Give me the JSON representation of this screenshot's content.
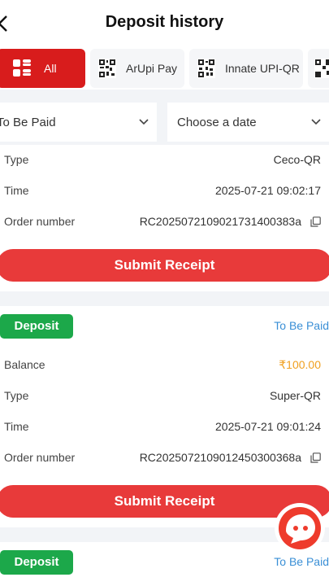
{
  "header": {
    "title": "Deposit history"
  },
  "tabs": [
    {
      "label": "All",
      "active": true,
      "icon": "grid-icon"
    },
    {
      "label": "ArUpi Pay",
      "active": false,
      "icon": "qr-code-icon"
    },
    {
      "label": "Innate UPI-QR",
      "active": false,
      "icon": "qr-code-icon"
    },
    {
      "label": "",
      "active": false,
      "icon": "qr-code-icon"
    }
  ],
  "filters": {
    "status": "To Be Paid",
    "date_placeholder": "Choose a date"
  },
  "labels": {
    "type": "Type",
    "time": "Time",
    "order_number": "Order number",
    "balance": "Balance",
    "submit": "Submit Receipt"
  },
  "records": [
    {
      "type": "Ceco-QR",
      "time": "2025-07-21 09:02:17",
      "order_number": "RC2025072109021731400383a"
    },
    {
      "badge": "Deposit",
      "status": "To Be Paid",
      "balance": "₹100.00",
      "type": "Super-QR",
      "time": "2025-07-21 09:01:24",
      "order_number": "RC2025072109012450300368a"
    },
    {
      "badge": "Deposit",
      "status": "To Be Paid"
    }
  ],
  "colors": {
    "accent_red": "#d81c1c",
    "submit_red": "#e83a3a",
    "deposit_green": "#1ca84a",
    "status_blue": "#3a8fd6",
    "amount_orange": "#f0a020"
  }
}
